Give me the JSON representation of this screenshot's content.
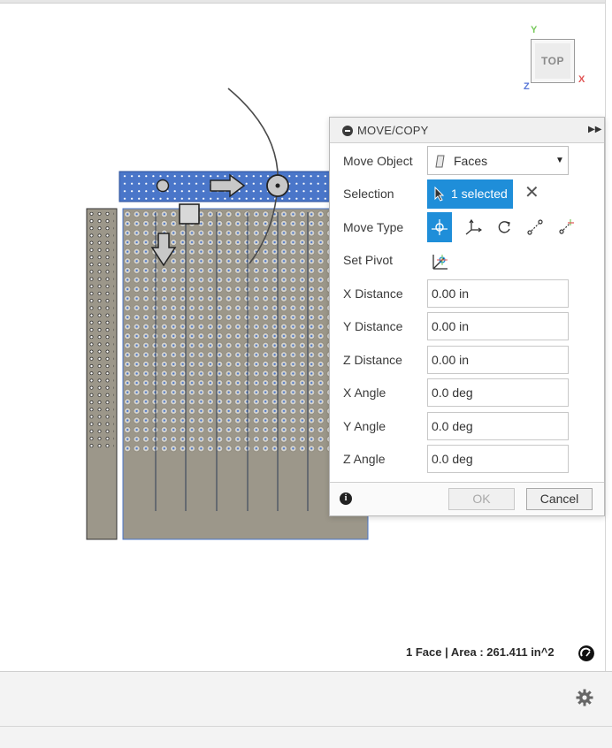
{
  "viewcube": {
    "face_label": "TOP",
    "axis_x": "X",
    "axis_y": "Y",
    "axis_z": "Z"
  },
  "panel": {
    "title": "MOVE/COPY",
    "move_object": {
      "label": "Move Object",
      "value": "Faces"
    },
    "selection": {
      "label": "Selection",
      "value": "1 selected"
    },
    "move_type": {
      "label": "Move Type",
      "active": "free-move"
    },
    "set_pivot": {
      "label": "Set Pivot"
    },
    "fields": [
      {
        "label": "X Distance",
        "value": "0.00 in"
      },
      {
        "label": "Y Distance",
        "value": "0.00 in"
      },
      {
        "label": "Z Distance",
        "value": "0.00 in"
      },
      {
        "label": "X Angle",
        "value": "0.0 deg"
      },
      {
        "label": "Y Angle",
        "value": "0.0 deg"
      },
      {
        "label": "Z Angle",
        "value": "0.0 deg"
      }
    ],
    "ok_label": "OK",
    "cancel_label": "Cancel"
  },
  "status": {
    "text": "1 Face | Area : 261.411 in^2"
  },
  "colors": {
    "accent": "#1f8ed9",
    "selection_face": "#4a76c9",
    "model_body": "#9c978a"
  }
}
